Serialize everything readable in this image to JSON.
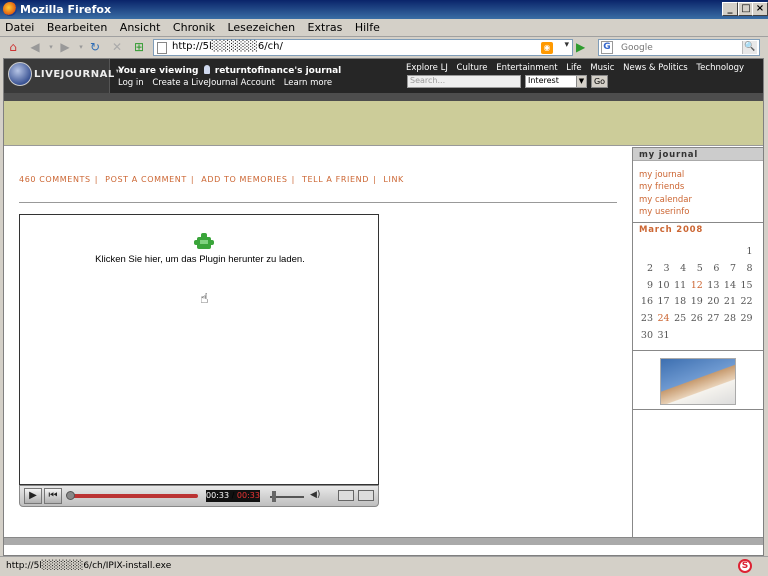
{
  "window": {
    "title": "Mozilla Firefox"
  },
  "menu": [
    "Datei",
    "Bearbeiten",
    "Ansicht",
    "Chronik",
    "Lesezeichen",
    "Extras",
    "Hilfe"
  ],
  "urlbar": {
    "value": "http://5l░░░░░░6/ch/"
  },
  "searchbar": {
    "engine": "G",
    "placeholder": "Google"
  },
  "lj": {
    "logo": "LIVEJOURNAL™",
    "viewing_prefix": "You are viewing",
    "viewing_user": "returntofinance's journal",
    "links": [
      "Log in",
      "Create a LiveJournal Account",
      "Learn more"
    ],
    "nav": [
      "Explore LJ",
      "Culture",
      "Entertainment",
      "Life",
      "Music",
      "News & Politics",
      "Technology"
    ],
    "search_placeholder": "Search...",
    "select_value": "Interest",
    "go": "Go"
  },
  "actions": [
    "460 COMMENTS",
    "POST A COMMENT",
    "ADD TO MEMORIES",
    "TELL A FRIEND",
    "LINK"
  ],
  "player": {
    "plugin_message": "Klicken Sie hier, um das Plugin herunter zu laden.",
    "time_current": "00:33",
    "time_total": "00:33"
  },
  "sidebar": {
    "heading_journal": "my journal",
    "links": [
      "my journal",
      "my friends",
      "my calendar",
      "my userinfo"
    ],
    "heading_month": "March 2008",
    "calendar": [
      [
        "",
        "",
        "",
        "",
        "",
        "",
        "1"
      ],
      [
        "2",
        "3",
        "4",
        "5",
        "6",
        "7",
        "8"
      ],
      [
        "9",
        "10",
        "11",
        "12",
        "13",
        "14",
        "15"
      ],
      [
        "16",
        "17",
        "18",
        "19",
        "20",
        "21",
        "22"
      ],
      [
        "23",
        "24",
        "25",
        "26",
        "27",
        "28",
        "29"
      ],
      [
        "30",
        "31",
        "",
        "",
        "",
        "",
        ""
      ]
    ],
    "highlighted_days": [
      "12",
      "24"
    ]
  },
  "status": {
    "text": "http://5l░░░░░░6/ch/IPIX-install.exe"
  },
  "colors": {
    "accent": "#cc6633",
    "banner": "#cccc99",
    "lj_header": "#262626"
  }
}
